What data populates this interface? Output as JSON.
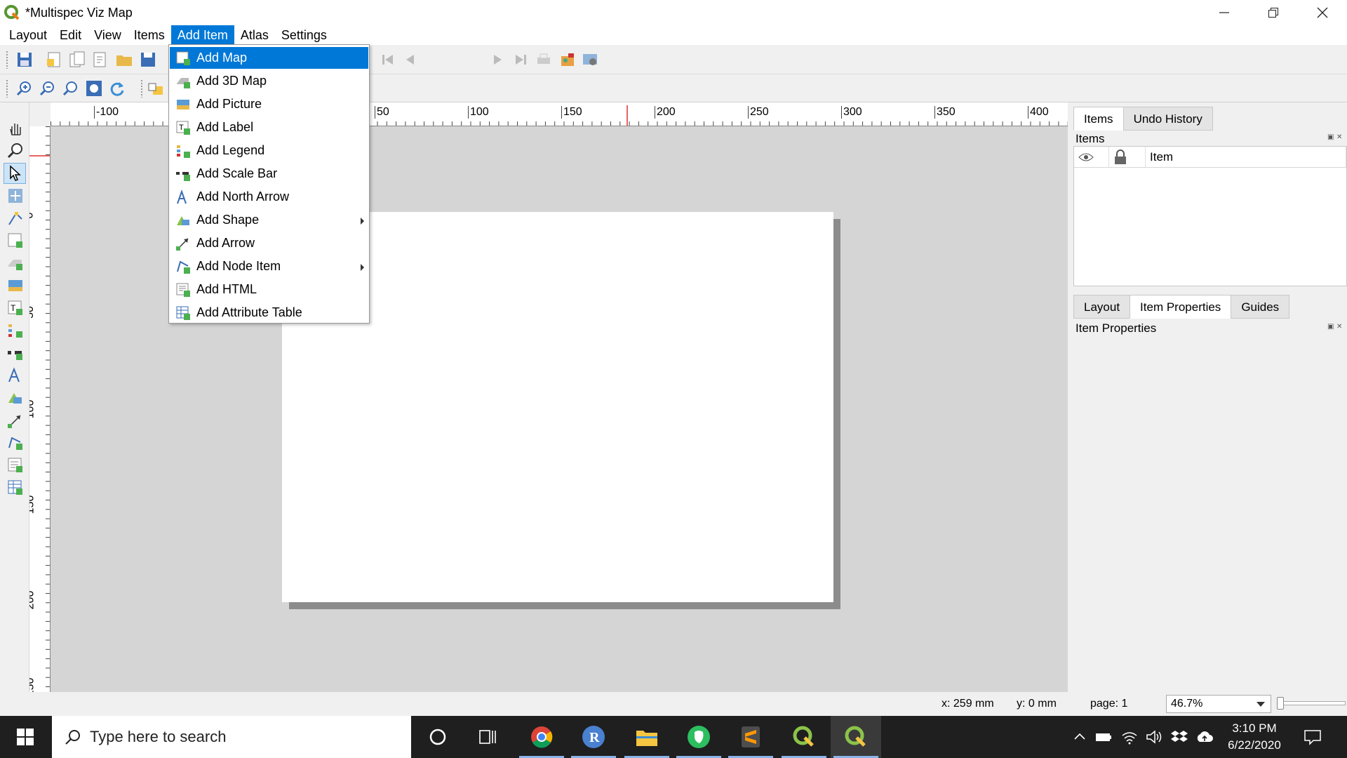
{
  "window": {
    "title": "*Multispec Viz Map",
    "minimize_icon": "minimize-icon",
    "restore_icon": "restore-icon",
    "close_icon": "close-icon"
  },
  "menubar": {
    "items": [
      {
        "label": "Layout"
      },
      {
        "label": "Edit"
      },
      {
        "label": "View"
      },
      {
        "label": "Items"
      },
      {
        "label": "Add Item",
        "active": true
      },
      {
        "label": "Atlas"
      },
      {
        "label": "Settings"
      }
    ]
  },
  "add_item_menu": {
    "items": [
      {
        "label": "Add Map",
        "icon": "add-map-icon",
        "highlighted": true
      },
      {
        "label": "Add 3D Map",
        "icon": "add-3d-map-icon"
      },
      {
        "label": "Add Picture",
        "icon": "add-picture-icon"
      },
      {
        "label": "Add Label",
        "icon": "add-label-icon"
      },
      {
        "label": "Add Legend",
        "icon": "add-legend-icon"
      },
      {
        "label": "Add Scale Bar",
        "icon": "add-scale-bar-icon"
      },
      {
        "label": "Add North Arrow",
        "icon": "add-north-arrow-icon"
      },
      {
        "label": "Add Shape",
        "icon": "add-shape-icon",
        "submenu": true
      },
      {
        "label": "Add Arrow",
        "icon": "add-arrow-icon"
      },
      {
        "label": "Add Node Item",
        "icon": "add-node-item-icon",
        "submenu": true
      },
      {
        "label": "Add HTML",
        "icon": "add-html-icon"
      },
      {
        "label": "Add Attribute Table",
        "icon": "add-attribute-table-icon"
      }
    ]
  },
  "atlas_toolbar": {
    "page_value": "1"
  },
  "rulers": {
    "horizontal_labels": [
      "-100",
      "50",
      "100",
      "150",
      "200",
      "250",
      "300",
      "350",
      "400"
    ],
    "vertical_labels": [
      "0",
      "50",
      "100",
      "150",
      "200",
      "250"
    ]
  },
  "dock": {
    "top_tabs": [
      {
        "label": "Items",
        "active": true
      },
      {
        "label": "Undo History"
      }
    ],
    "items_panel_title": "Items",
    "items_table_header": "Item",
    "bottom_tabs": [
      {
        "label": "Layout"
      },
      {
        "label": "Item Properties",
        "active": true
      },
      {
        "label": "Guides"
      }
    ],
    "properties_panel_title": "Item Properties"
  },
  "statusbar": {
    "x_coord": "x: 259 mm",
    "y_coord": "y: 0 mm",
    "page": "page: 1",
    "zoom": "46.7%"
  },
  "taskbar": {
    "search_placeholder": "Type here to search",
    "time": "3:10 PM",
    "date": "6/22/2020"
  },
  "colors": {
    "accent": "#0078d7",
    "canvas": "#d5d5d5",
    "taskbar": "#1f1f1f",
    "qgis_green": "#589632"
  }
}
